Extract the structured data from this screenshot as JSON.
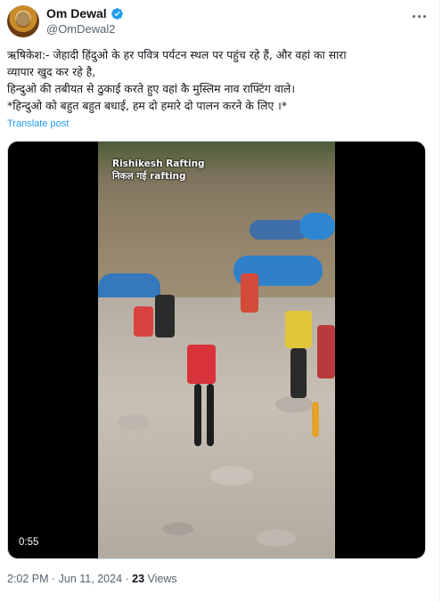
{
  "author": {
    "display_name": "Om Dewal",
    "handle": "@OmDewal2",
    "verified_badge_icon": "verified-badge-icon",
    "badge_color": "#1d9bf0"
  },
  "post": {
    "lines": [
      "ऋषिकेश:- जेहादी हिंदुओ के हर पवित्र पर्यटन स्थल पर पहुंच रहे हैं, और वहां का सारा",
      "व्यापार खुद कर रहे है,",
      "हिन्दुओ  की तबीयत से ठुकाई करते हुए वहां कै मुस्लिम नाव राफ्टिंग वाले।",
      " *हिन्दुओ को बहुत बहुत बधाई, हम दो हमारे दो पालन करने के लिए ।*"
    ],
    "translate_label": "Translate post"
  },
  "video": {
    "overlay_title": "Rishikesh Rafting",
    "overlay_subtitle": "निकल गई rafting",
    "duration": "0:55"
  },
  "meta": {
    "time_date": "2:02 PM · Jun 11, 2024 · ",
    "views_count": "23",
    "views_label": " Views"
  },
  "colors": {
    "link": "#1d9bf0",
    "secondary_text": "#536471",
    "primary_text": "#0f1419"
  }
}
